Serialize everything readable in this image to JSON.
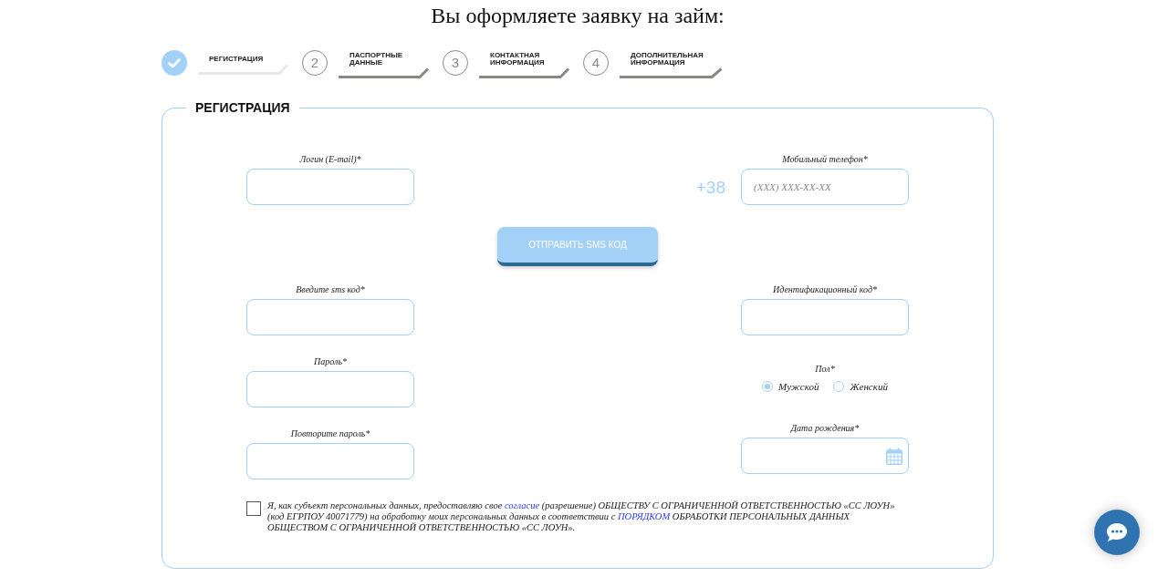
{
  "title": "Вы оформляете заявку на займ:",
  "steps": [
    {
      "label": "РЕГИСТРАЦИЯ",
      "done": true
    },
    {
      "number": "2",
      "label": "ПАСПОРТНЫЕ ДАННЫЕ",
      "done": false
    },
    {
      "number": "3",
      "label": "КОНТАКТНАЯ ИНФОРМАЦИЯ",
      "done": false
    },
    {
      "number": "4",
      "label": "ДОПОЛНИТЕЛЬНАЯ ИНФОРМАЦИЯ",
      "done": false
    }
  ],
  "form": {
    "legend": "РЕГИСТРАЦИЯ",
    "left_fields": [
      {
        "kind": "text",
        "label": "Логин (E-mail)*"
      },
      {
        "kind": "text",
        "label": "Введите sms код*"
      },
      {
        "kind": "text",
        "label": "Пароль*"
      },
      {
        "kind": "text",
        "label": "Повторите пароль*"
      }
    ],
    "right_fields": [
      {
        "kind": "phone",
        "label": "Мобильный телефон*",
        "prefix": "+38",
        "placeholder": "(XXX) XXX-XX-XX"
      },
      {
        "kind": "text",
        "label": "Идентификационный код*"
      },
      {
        "kind": "radio",
        "label": "Пол*",
        "options": [
          {
            "label": "Мужской",
            "selected": true
          },
          {
            "label": "Женский",
            "selected": false
          }
        ]
      },
      {
        "kind": "date",
        "label": "Дата рождения*"
      }
    ],
    "sms_button": "ОТПРАВИТЬ SMS КОД",
    "consent": {
      "checked": false,
      "parts": [
        {
          "kind": "text",
          "text": "Я, как субъект персональных данных, предоставляю свое "
        },
        {
          "kind": "link",
          "text": "согласие"
        },
        {
          "kind": "text",
          "text": " (разрешение) ОБЩЕСТВУ С ОГРАНИЧЕННОЙ ОТВЕТСТВЕННОСТЬЮ «СС ЛОУН» (код ЕГРПОУ 40071779) на обработку моих персональных данных в соответствии с "
        },
        {
          "kind": "link",
          "text": "ПОРЯДКОМ"
        },
        {
          "kind": "text",
          "text": " ОБРАБОТКИ ПЕРСОНАЛЬНЫХ ДАННЫХ ОБЩЕСТВОМ С ОГРАНИЧЕННОЙ ОТВЕТСТВЕННОСТЬЮ «СС ЛОУН»."
        }
      ]
    }
  }
}
